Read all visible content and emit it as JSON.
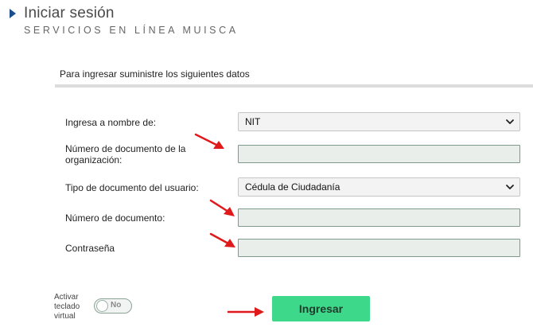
{
  "header": {
    "title": "Iniciar sesión",
    "subtitle": "SERVICIOS EN LÍNEA MUISCA"
  },
  "form": {
    "intro": "Para ingresar suministre los siguientes datos",
    "fields": [
      {
        "label": "Ingresa a nombre de:",
        "type": "select",
        "value": "NIT"
      },
      {
        "label": "Número de documento de la organización:",
        "type": "text",
        "value": ""
      },
      {
        "label": "Tipo de documento del usuario:",
        "type": "select",
        "value": "Cédula de Ciudadanía"
      },
      {
        "label": "Número de documento:",
        "type": "text",
        "value": ""
      },
      {
        "label": "Contraseña",
        "type": "password",
        "value": ""
      }
    ]
  },
  "virtual_keyboard": {
    "label": "Activar teclado virtual",
    "state": "No"
  },
  "submit_label": "Ingresar",
  "colors": {
    "accent": "#3ed88a",
    "annotation_arrow": "#e0191b",
    "title_arrow": "#1a4f8c"
  }
}
